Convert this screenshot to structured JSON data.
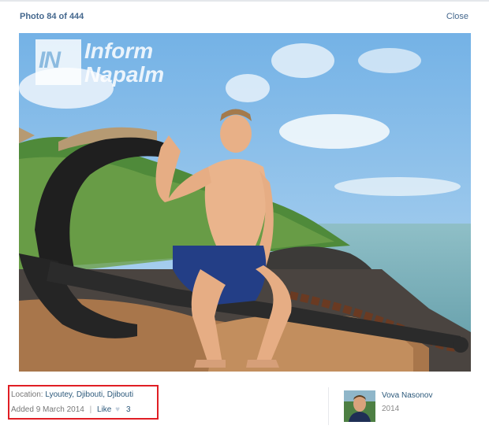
{
  "header": {
    "counter": "Photo 84 of 444",
    "close_label": "Close"
  },
  "watermark": {
    "logo_text": "IN",
    "line1": "Inform",
    "line2": "Napalm"
  },
  "meta": {
    "location_label": "Location:",
    "location_value": "Lyoutey, Djibouti, Djibouti",
    "added_text": "Added 9 March 2014",
    "separator": "|",
    "like_label": "Like",
    "like_count": "3"
  },
  "owner": {
    "name": "Vova Nasonov",
    "year": "2014"
  },
  "colors": {
    "link": "#2b587a",
    "highlight_box": "#e01e24",
    "header_text": "#45688e"
  },
  "icons": {
    "like": "heart-icon"
  }
}
